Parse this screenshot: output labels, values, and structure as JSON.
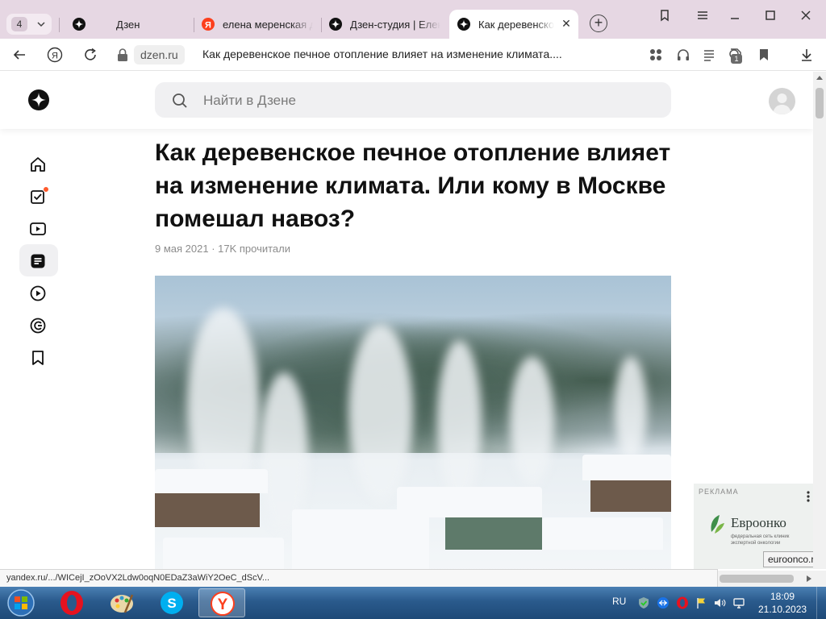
{
  "browser": {
    "tab_count": "4",
    "tabs": [
      {
        "label": "Дзен"
      },
      {
        "label": "елена меренская д"
      },
      {
        "label": "Дзен-студия | Елена"
      },
      {
        "label": "Как деревенское п"
      }
    ],
    "address": {
      "domain": "dzen.ru",
      "page_title": "Как деревенское печное отопление влияет на изменение климата....",
      "extension_badge": "1"
    },
    "status_url": "yandex.ru/.../WICejI_zOoVX2Ldw0oqN0EDaZ3aWiY2OeC_dScV..."
  },
  "page": {
    "search_placeholder": "Найти в Дзене",
    "article": {
      "title": "Как деревенское печное отопление влияет на изменение климата. Или кому в Москве помешал навоз?",
      "meta": "9 мая 2021 · 17K прочитали"
    },
    "ad": {
      "label": "РЕКЛАМА",
      "brand": "Евроонко",
      "subtitle": "федеральная сеть клиник экспертной онкологии",
      "domain": "euroonco.ru"
    }
  },
  "taskbar": {
    "language": "RU",
    "time": "18:09",
    "date": "21.10.2023"
  },
  "colors": {
    "tabstrip_bg": "#e6d7e3",
    "notification_dot": "#ff5a2c",
    "taskbar_blue": "#2a5a8c"
  }
}
